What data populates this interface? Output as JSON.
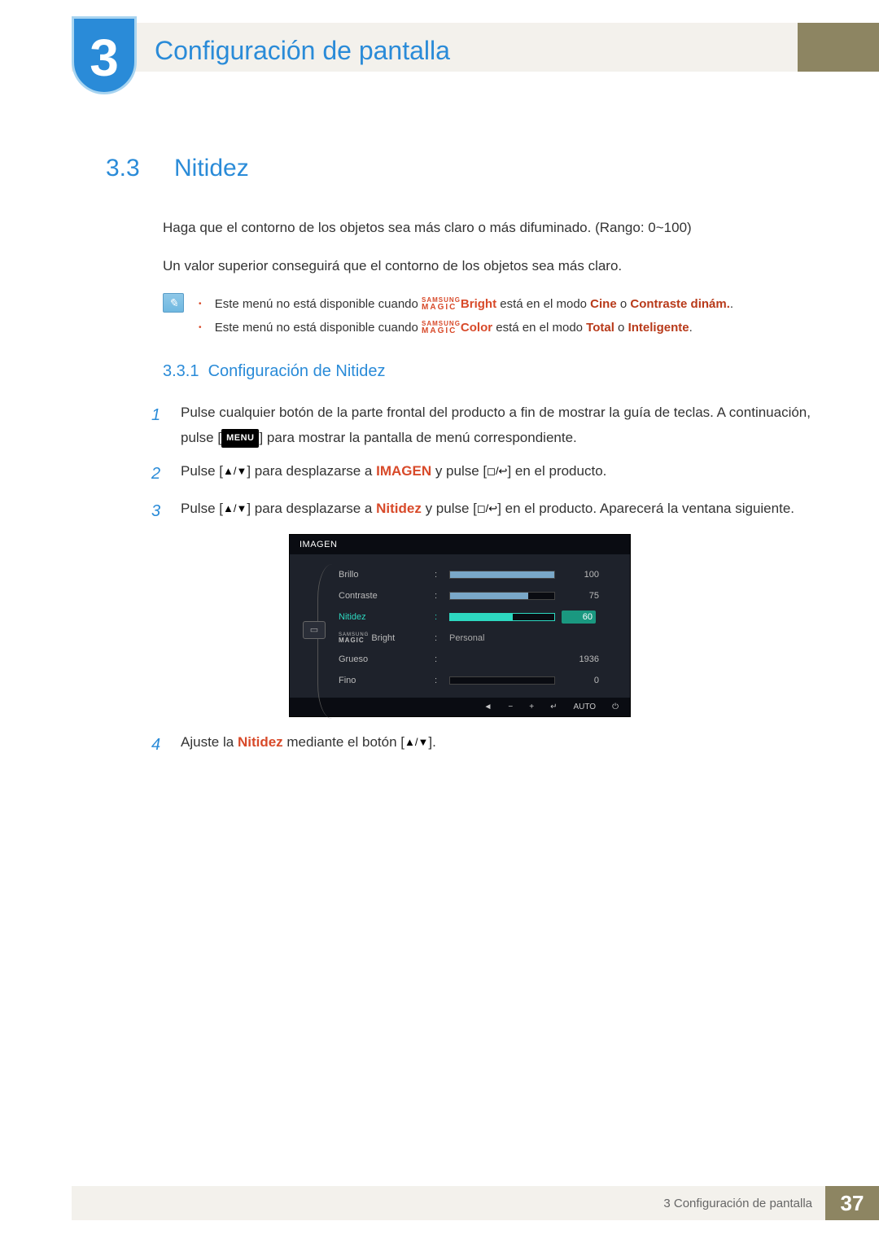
{
  "header": {
    "chapter_number": "3",
    "chapter_title": "Configuración de pantalla"
  },
  "section": {
    "number": "3.3",
    "title": "Nitidez",
    "intro1": "Haga que el contorno de los objetos sea más claro o más difuminado. (Rango: 0~100)",
    "intro2": "Un valor superior conseguirá que el contorno de los objetos sea más claro.",
    "notes": [
      {
        "prefix": "Este menú no está disponible cuando ",
        "magic_suffix": "Bright",
        "mid": " está en el modo ",
        "kw1": "Cine",
        "or": " o ",
        "kw2": "Contraste dinám.",
        "end": "."
      },
      {
        "prefix": "Este menú no está disponible cuando ",
        "magic_suffix": "Color",
        "mid": " está en el modo ",
        "kw1": "Total",
        "or": " o ",
        "kw2": "Inteligente",
        "end": "."
      }
    ],
    "samsung_magic": {
      "top": "SAMSUNG",
      "bottom": "MAGIC"
    }
  },
  "subsection": {
    "number": "3.3.1",
    "title": "Configuración de Nitidez",
    "steps": [
      {
        "n": "1",
        "pre": "Pulse cualquier botón de la parte frontal del producto a fin de mostrar la guía de teclas. A continuación, pulse [",
        "menu": "MENU",
        "post": "] para mostrar la pantalla de menú correspondiente."
      },
      {
        "n": "2",
        "pre": "Pulse [",
        "mid1": "] para desplazarse a ",
        "kw": "IMAGEN",
        "mid2": " y pulse [",
        "post": "] en el producto."
      },
      {
        "n": "3",
        "pre": "Pulse [",
        "mid1": "] para desplazarse a ",
        "kw": "Nitidez",
        "mid2": " y pulse [",
        "post": "] en el producto. Aparecerá la ventana siguiente."
      },
      {
        "n": "4",
        "pre": "Ajuste la ",
        "kw": "Nitidez",
        "mid": " mediante el botón [",
        "post": "]."
      }
    ]
  },
  "osd": {
    "title": "IMAGEN",
    "rows": [
      {
        "label": "Brillo",
        "value": "100",
        "fill": 100,
        "type": "bar"
      },
      {
        "label": "Contraste",
        "value": "75",
        "fill": 75,
        "type": "bar"
      },
      {
        "label": "Nitidez",
        "value": "60",
        "fill": 60,
        "type": "bar",
        "selected": true
      },
      {
        "label": "Bright",
        "value": "Personal",
        "type": "text",
        "magic": true
      },
      {
        "label": "Grueso",
        "value": "1936",
        "type": "value_only"
      },
      {
        "label": "Fino",
        "value": "0",
        "fill": 0,
        "type": "bar"
      }
    ],
    "footer": [
      "◄",
      "−",
      "+",
      "↵",
      "AUTO",
      "⏻"
    ]
  },
  "footer": {
    "text": "3 Configuración de pantalla",
    "page": "37"
  }
}
